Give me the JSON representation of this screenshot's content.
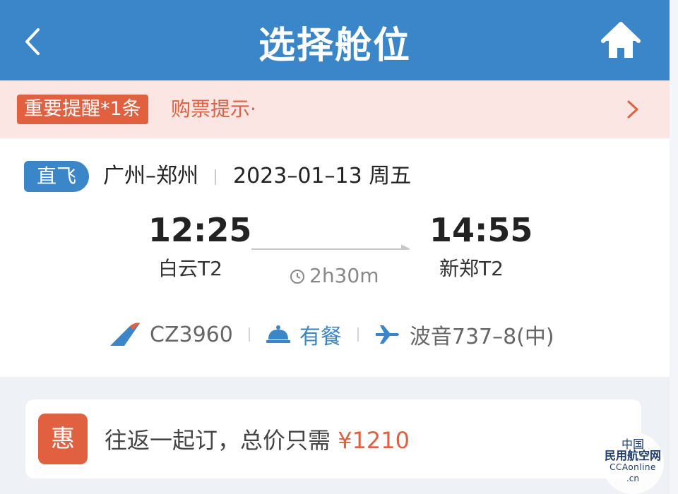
{
  "header": {
    "title": "选择舱位",
    "back_icon": "chevron-left-icon",
    "home_icon": "home-icon",
    "bg_color": "#3a86c9"
  },
  "notice": {
    "badge": "重要提醒*1条",
    "text": "购票提示·",
    "chevron_icon": "chevron-right-icon",
    "accent_color": "#e0603f"
  },
  "flight": {
    "direct_tag": "直飞",
    "route": "广州–郑州",
    "date": "2023–01–13 周五",
    "departure": {
      "time": "12:25",
      "terminal": "白云T2"
    },
    "arrival": {
      "time": "14:55",
      "terminal": "新郑T2"
    },
    "duration": "2h30m",
    "flight_no": "CZ3960",
    "meal": "有餐",
    "aircraft": "波音737–8(中)"
  },
  "promo": {
    "badge": "惠",
    "text": "往返一起订，总价只需",
    "price": "¥1210"
  },
  "watermark": {
    "line1": "中国",
    "line2": "民用航空网",
    "line3": "CCAonline",
    "line4": ".cn"
  }
}
